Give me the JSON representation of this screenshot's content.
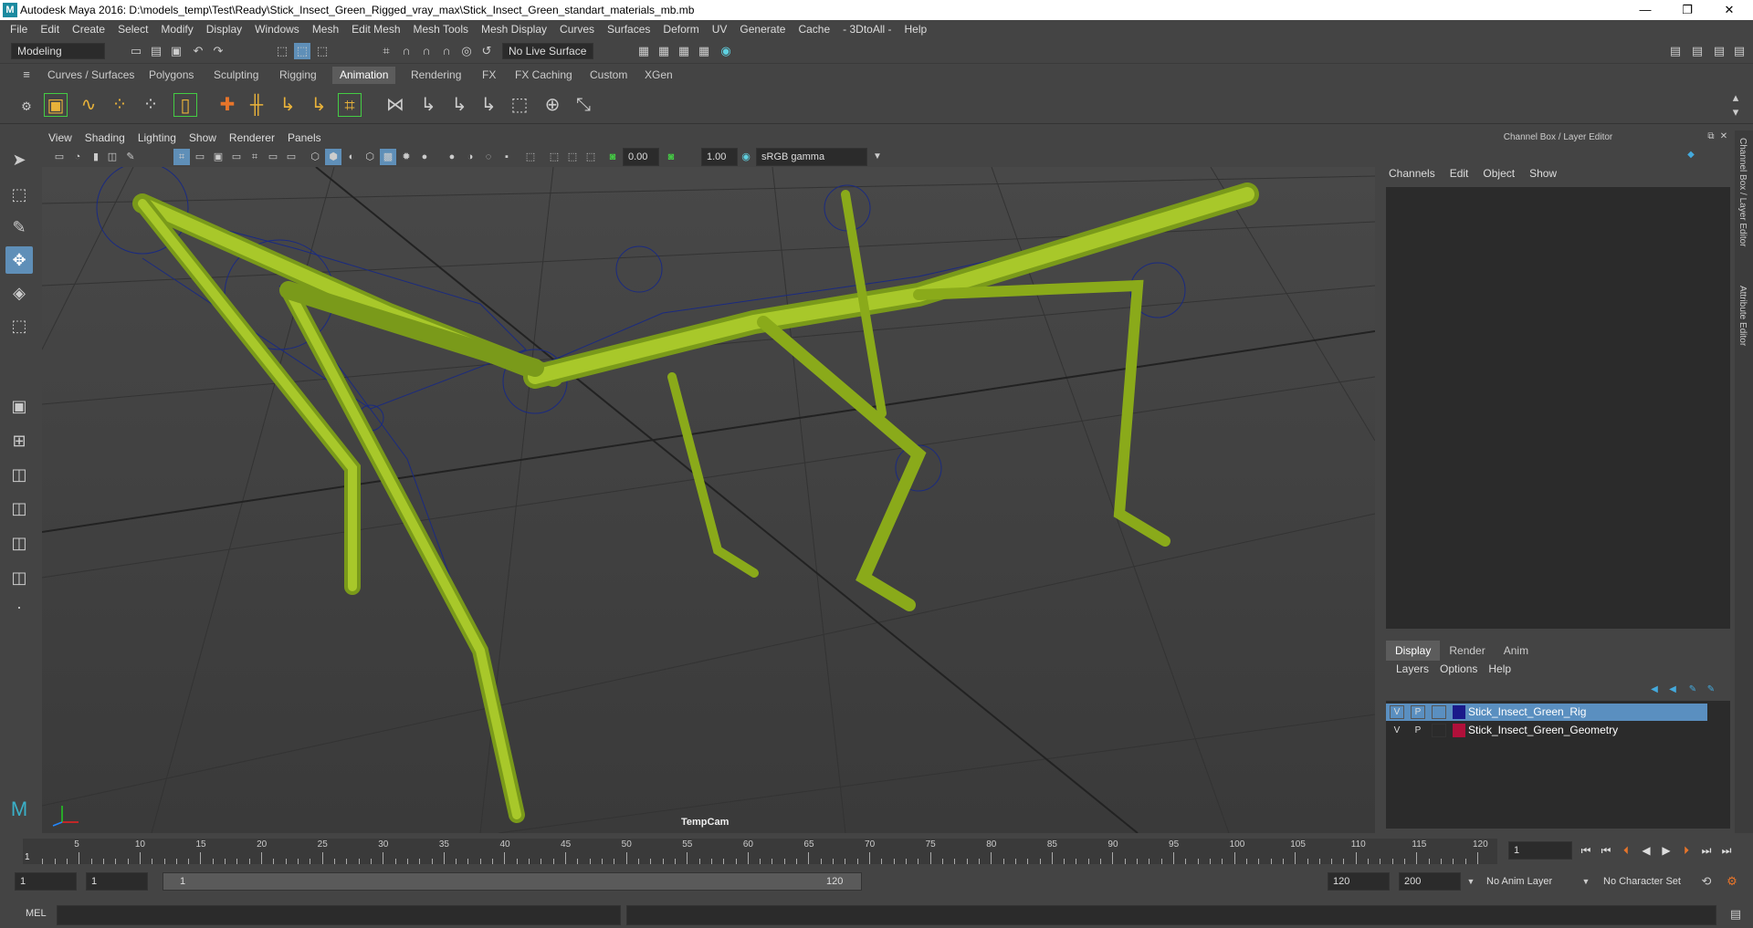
{
  "window": {
    "title": "Autodesk Maya 2016: D:\\models_temp\\Test\\Ready\\Stick_Insect_Green_Rigged_vray_max\\Stick_Insect_Green_standart_materials_mb.mb",
    "logo": "M",
    "min": "—",
    "max": "❐",
    "close": "✕"
  },
  "menu": [
    "File",
    "Edit",
    "Create",
    "Select",
    "Modify",
    "Display",
    "Windows",
    "Mesh",
    "Edit Mesh",
    "Mesh Tools",
    "Mesh Display",
    "Curves",
    "Surfaces",
    "Deform",
    "UV",
    "Generate",
    "Cache",
    "- 3DtoAll -",
    "Help"
  ],
  "status": {
    "mode": "Modeling",
    "live_surface": "No Live Surface"
  },
  "shelf_tabs": [
    "Curves / Surfaces",
    "Polygons",
    "Sculpting",
    "Rigging",
    "Animation",
    "Rendering",
    "FX",
    "FX Caching",
    "Custom",
    "XGen"
  ],
  "active_shelf_tab": "Animation",
  "viewport": {
    "menu": [
      "View",
      "Shading",
      "Lighting",
      "Show",
      "Renderer",
      "Panels"
    ],
    "exposure": "0.00",
    "gamma": "1.00",
    "color_space": "sRGB gamma",
    "camera": "TempCam"
  },
  "right_panel": {
    "title": "Channel Box / Layer Editor",
    "menu": [
      "Channels",
      "Edit",
      "Object",
      "Show"
    ],
    "tabs": [
      "Display",
      "Render",
      "Anim"
    ],
    "layer_menu": [
      "Layers",
      "Options",
      "Help"
    ],
    "layers": [
      {
        "v": "V",
        "p": "P",
        "name": "Stick_Insect_Green_Rig",
        "color": "#1a1a8a"
      },
      {
        "v": "V",
        "p": "P",
        "name": "Stick_Insect_Green_Geometry",
        "color": "#b0103a"
      }
    ],
    "side_tabs": [
      "Channel Box / Layer Editor",
      "Attribute Editor"
    ]
  },
  "timeline": {
    "ticks": [
      "5",
      "10",
      "15",
      "20",
      "25",
      "30",
      "35",
      "40",
      "45",
      "50",
      "55",
      "60",
      "65",
      "70",
      "75",
      "80",
      "85",
      "90",
      "95",
      "100",
      "105",
      "110",
      "115",
      "120"
    ],
    "start_marker": "1",
    "current_frame": "1"
  },
  "range": {
    "start": "1",
    "inner_start": "1",
    "slider_start": "1",
    "slider_end": "120",
    "end": "120",
    "max": "200",
    "anim_layer": "No Anim Layer",
    "char_set": "No Character Set"
  },
  "command": {
    "lang": "MEL"
  }
}
